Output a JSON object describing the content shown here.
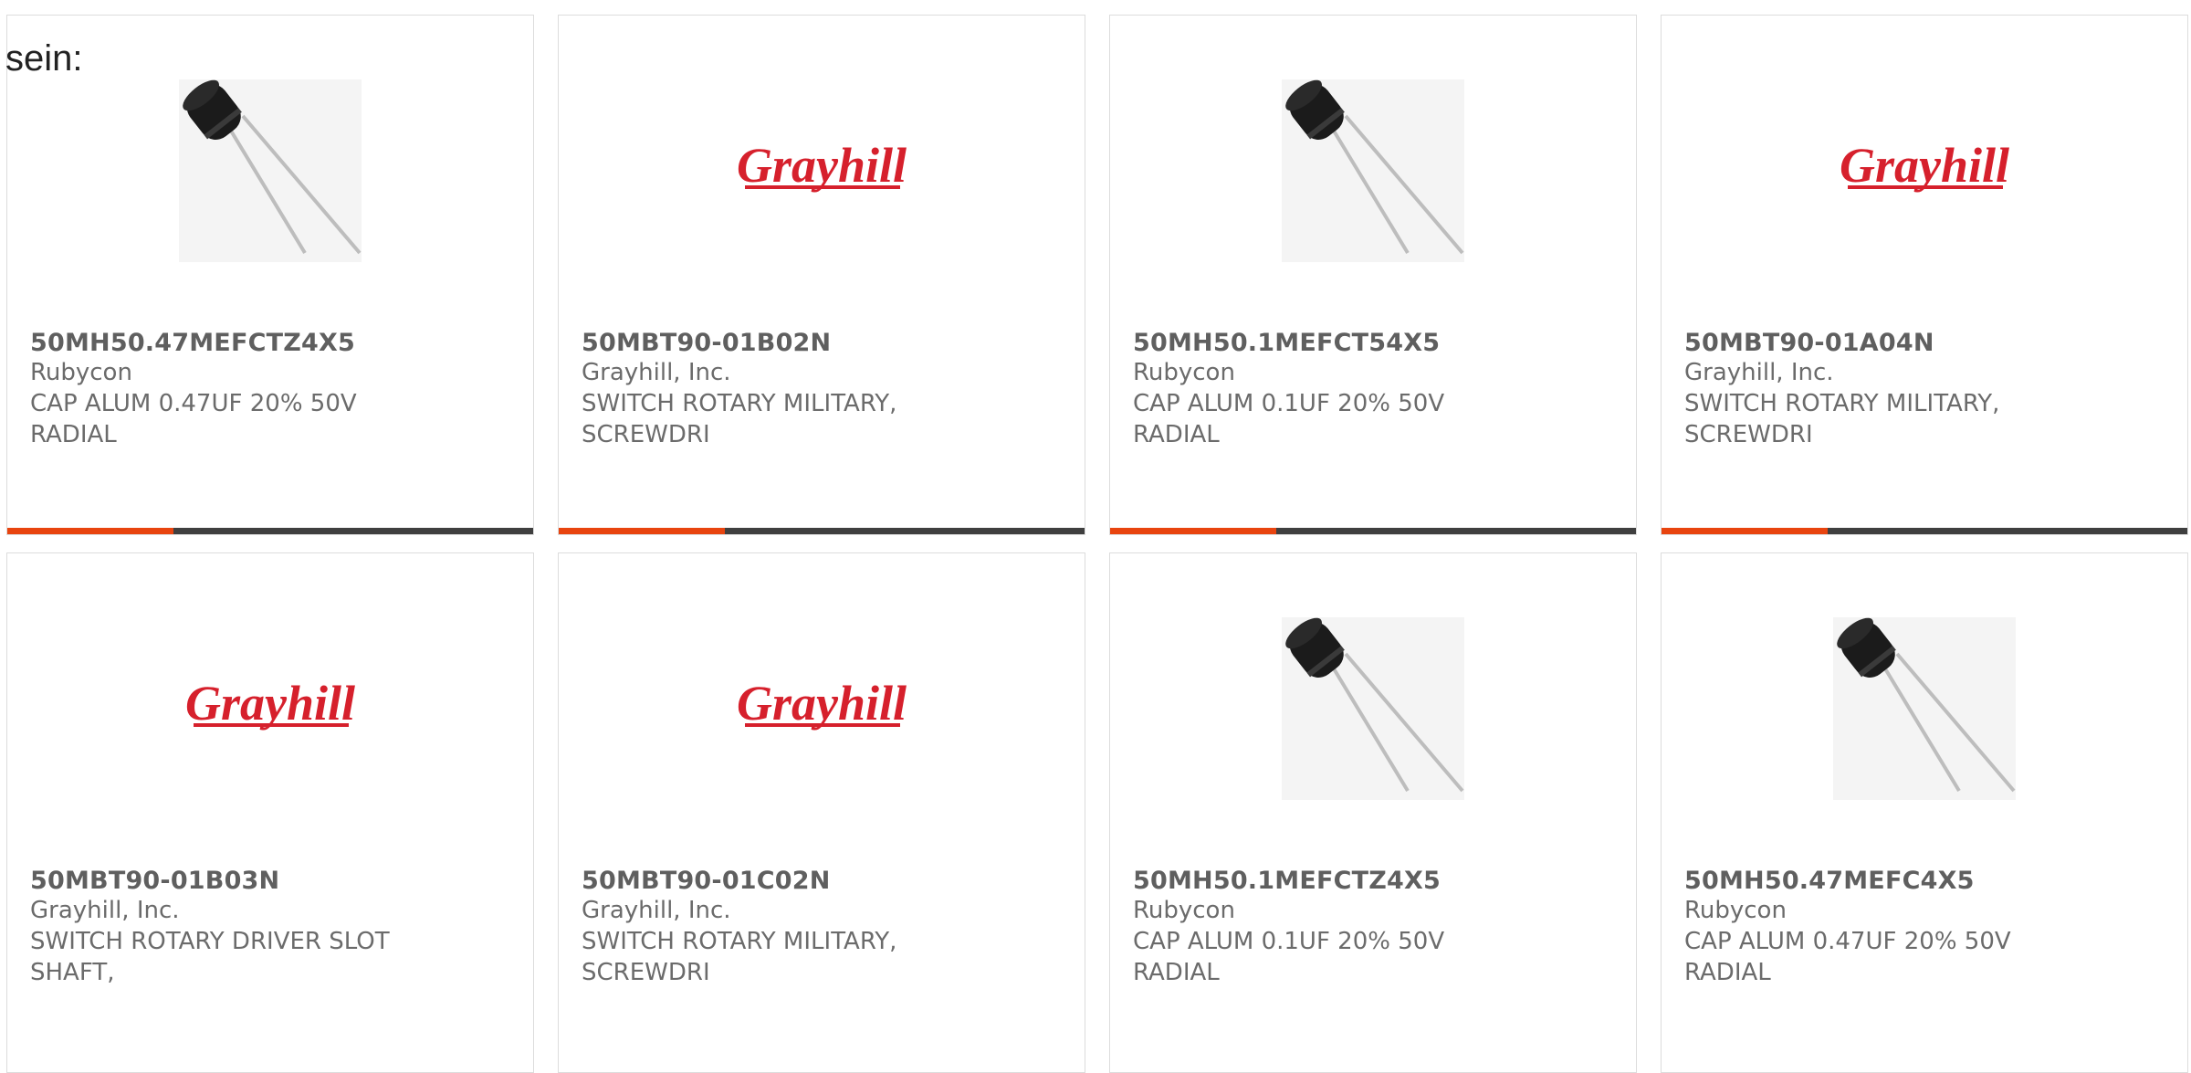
{
  "lead_text": "sein:",
  "colors": {
    "accent": "#e8440f",
    "bar": "#3f3f3f",
    "grayhill_red": "#d6202c"
  },
  "products": [
    {
      "part": "50MH50.47MEFCTZ4X5",
      "manufacturer": "Rubycon",
      "description": "CAP ALUM 0.47UF 20% 50V RADIAL",
      "image": "capacitor-image"
    },
    {
      "part": "50MBT90-01B02N",
      "manufacturer": "Grayhill, Inc.",
      "description": "SWITCH ROTARY MILITARY, SCREWDRI",
      "image": "grayhill-logo",
      "logo_text": "Grayhill"
    },
    {
      "part": "50MH50.1MEFCT54X5",
      "manufacturer": "Rubycon",
      "description": "CAP ALUM 0.1UF 20% 50V RADIAL",
      "image": "capacitor-image"
    },
    {
      "part": "50MBT90-01A04N",
      "manufacturer": "Grayhill, Inc.",
      "description": "SWITCH ROTARY MILITARY, SCREWDRI",
      "image": "grayhill-logo",
      "logo_text": "Grayhill"
    },
    {
      "part": "50MBT90-01B03N",
      "manufacturer": "Grayhill, Inc.",
      "description": "SWITCH ROTARY DRIVER SLOT SHAFT,",
      "image": "grayhill-logo",
      "logo_text": "Grayhill"
    },
    {
      "part": "50MBT90-01C02N",
      "manufacturer": "Grayhill, Inc.",
      "description": "SWITCH ROTARY MILITARY, SCREWDRI",
      "image": "grayhill-logo",
      "logo_text": "Grayhill"
    },
    {
      "part": "50MH50.1MEFCTZ4X5",
      "manufacturer": "Rubycon",
      "description": "CAP ALUM 0.1UF 20% 50V RADIAL",
      "image": "capacitor-image"
    },
    {
      "part": "50MH50.47MEFC4X5",
      "manufacturer": "Rubycon",
      "description": "CAP ALUM 0.47UF 20% 50V RADIAL",
      "image": "capacitor-image"
    }
  ]
}
